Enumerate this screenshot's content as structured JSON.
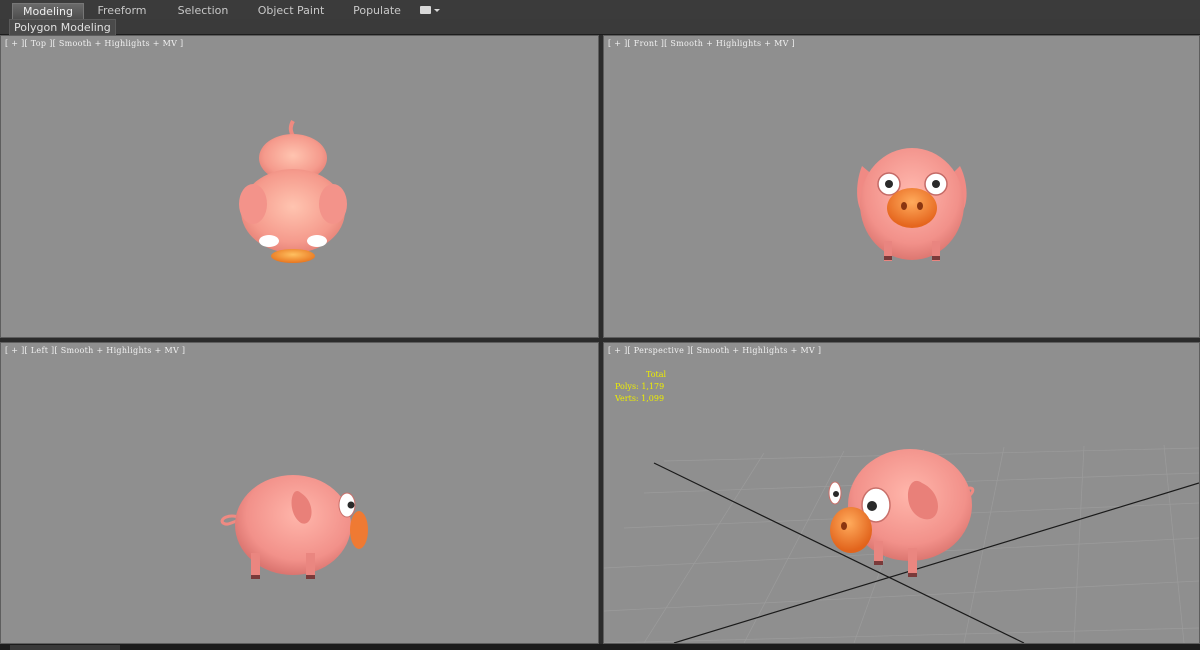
{
  "ribbon": {
    "tabs": [
      "Modeling",
      "Freeform",
      "Selection",
      "Object Paint",
      "Populate"
    ],
    "active_tab": "Modeling",
    "extra_icon": "display-dropdown-icon"
  },
  "subbar": {
    "label": "Polygon Modeling"
  },
  "viewports": {
    "top": {
      "label": "[ + ][ Top ][ Smooth + Highlights + MV ]"
    },
    "front": {
      "label": "[ + ][ Front ][ Smooth + Highlights + MV ]"
    },
    "left": {
      "label": "[ + ][ Left ][ Smooth + Highlights + MV ]"
    },
    "perspective": {
      "label": "[ + ][ Perspective ][ Smooth + Highlights + MV ]",
      "stats": {
        "header": "Total",
        "polys_label": "Polys:",
        "polys_value": "1,179",
        "verts_label": "Verts:",
        "verts_value": "1,099"
      }
    }
  },
  "colors": {
    "viewport_bg": "#8f8f8f",
    "pig_pink": "#f08f8f",
    "snout_orange": "#f07a3c",
    "stats_yellow": "#eded00"
  }
}
